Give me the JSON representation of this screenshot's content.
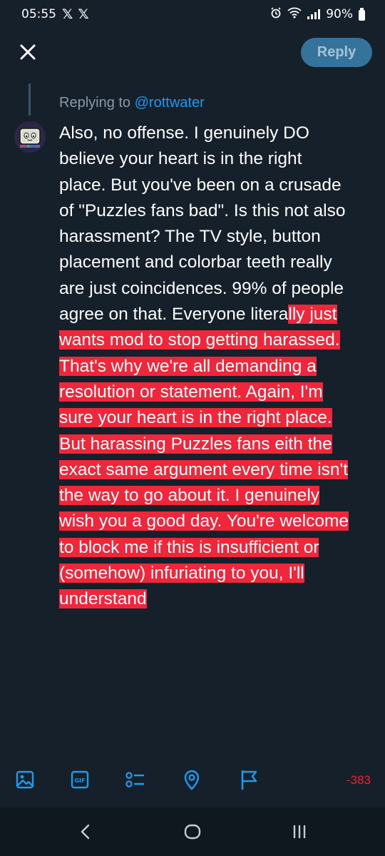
{
  "status_bar": {
    "time": "05:55",
    "notification_icons": [
      "x-logo",
      "x-logo"
    ],
    "battery": "90%"
  },
  "topbar": {
    "reply_label": "Reply"
  },
  "reply_context": {
    "prefix": "Replying to",
    "handle": "@rottwater"
  },
  "tweet": {
    "lines_plain": [
      "Also, no offense. I genuinely DO",
      "believe your heart is in the right",
      "place. But you've been on a crusade",
      "of \"Puzzles fans bad\". Is this not also",
      "harassment? The TV style, button",
      "placement and colorbar teeth really",
      "are just coincidences. 99% of people"
    ],
    "line8_plain": "agree on that. Everyone litera",
    "line8_highlight": "lly just",
    "lines_highlight": [
      "wants mod to stop getting harassed.",
      "That's why we're all demanding a",
      "resolution or statement. Again, I'm",
      "sure your heart is in the right place.",
      "But harassing Puzzles fans eith the",
      "exact same argument every time isn't",
      "the way to go about it. I genuinely",
      "wish you a good day. You're welcome",
      "to block me if this is insufficient or",
      "(somehow) infuriating to you, I'll",
      "understand"
    ],
    "highlight_color": "#f0263a"
  },
  "toolbar": {
    "icons": [
      "image-icon",
      "gif-icon",
      "poll-icon",
      "location-icon",
      "flag-icon"
    ],
    "gif_label": "GIF",
    "char_count": "-383"
  },
  "colors": {
    "background": "#15202b",
    "accent": "#1d9bf0",
    "reply_button": "#36739b",
    "error": "#f4212e"
  }
}
